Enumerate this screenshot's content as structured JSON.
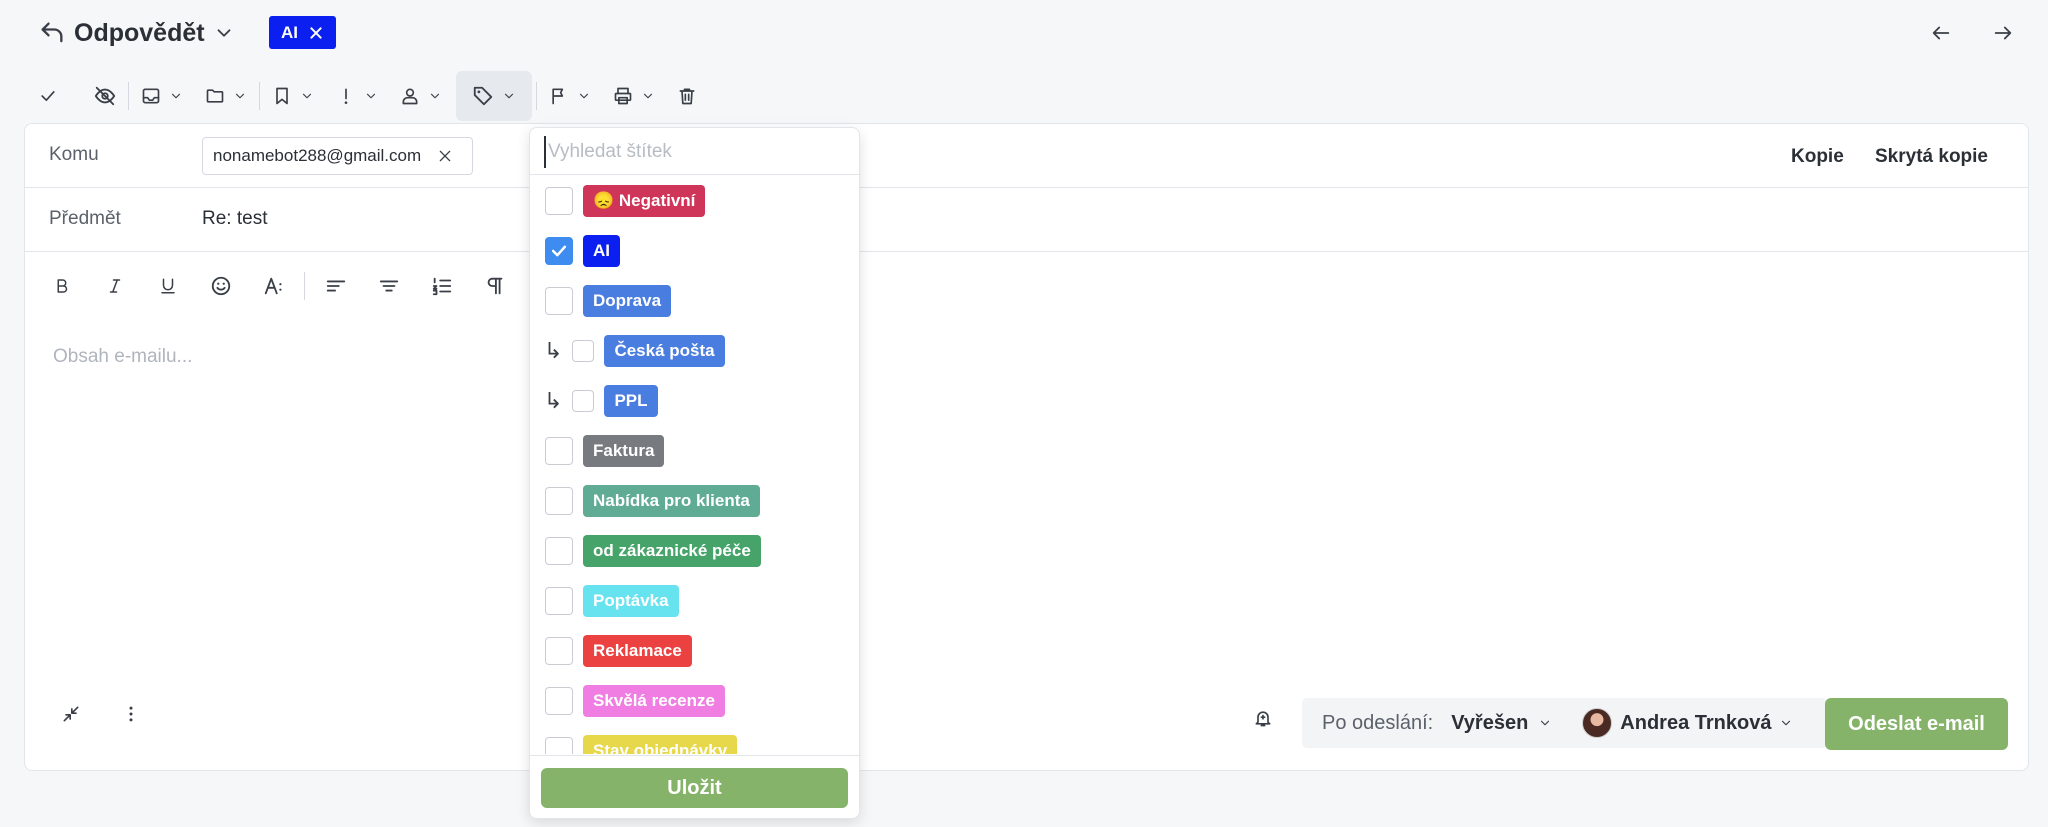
{
  "header": {
    "reply_label": "Odpovědět",
    "tag_chip": "AI"
  },
  "recipients": {
    "to_label": "Komu",
    "to_email": "nonamebot288@gmail.com",
    "cc_label": "Kopie",
    "bcc_label": "Skrytá kopie"
  },
  "subject": {
    "label": "Předmět",
    "value": "Re: test"
  },
  "editor": {
    "placeholder": "Obsah e-mailu..."
  },
  "footer": {
    "after_send_label": "Po odeslání:",
    "status": "Vyřešen",
    "assignee": "Andrea Trnková",
    "send_label": "Odeslat e-mail"
  },
  "tag_dropdown": {
    "search_placeholder": "Vyhledat štítek",
    "save_label": "Uložit",
    "tags": [
      {
        "label": "😞 Negativní",
        "color": "#cf3558",
        "checked": false,
        "child": false
      },
      {
        "label": "AI",
        "color": "#0a1ff0",
        "checked": true,
        "child": false
      },
      {
        "label": "Doprava",
        "color": "#4a7de0",
        "checked": false,
        "child": false
      },
      {
        "label": "Česká pošta",
        "color": "#4a7de0",
        "checked": false,
        "child": true
      },
      {
        "label": "PPL",
        "color": "#4a7de0",
        "checked": false,
        "child": true
      },
      {
        "label": "Faktura",
        "color": "#777a7e",
        "checked": false,
        "child": false
      },
      {
        "label": "Nabídka pro klienta",
        "color": "#5fab94",
        "checked": false,
        "child": false
      },
      {
        "label": "od zákaznické péče",
        "color": "#46a36a",
        "checked": false,
        "child": false
      },
      {
        "label": "Poptávka",
        "color": "#67e3ef",
        "checked": false,
        "child": false
      },
      {
        "label": "Reklamace",
        "color": "#ec4141",
        "checked": false,
        "child": false
      },
      {
        "label": "Skvělá recenze",
        "color": "#f07ee2",
        "checked": false,
        "child": false
      },
      {
        "label": "Stav objednávky",
        "color": "#e7d74a",
        "checked": false,
        "child": false
      }
    ]
  },
  "icons": [
    "back-reply-icon",
    "chevron-down-icon",
    "close-icon",
    "arrow-left-icon",
    "arrow-right-icon",
    "check-icon",
    "eye-off-icon",
    "inbox-icon",
    "folder-icon",
    "bookmark-icon",
    "exclamation-icon",
    "user-icon",
    "tag-icon",
    "flag-icon",
    "printer-icon",
    "trash-icon",
    "bold-icon",
    "italic-icon",
    "underline-icon",
    "emoji-icon",
    "text-size-icon",
    "align-left-icon",
    "align-center-icon",
    "numbered-list-icon",
    "paragraph-icon",
    "collapse-icon",
    "more-vertical-icon",
    "bell-icon",
    "check-mark-icon"
  ]
}
